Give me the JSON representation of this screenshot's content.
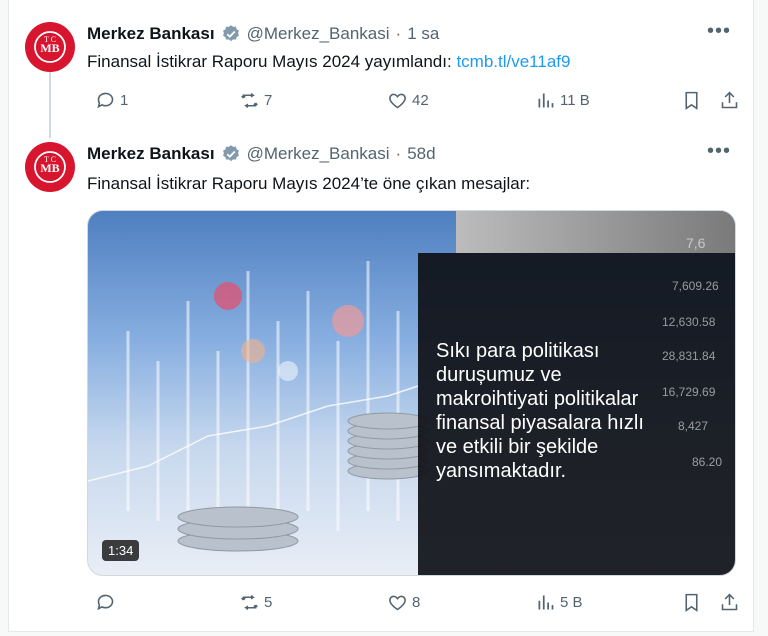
{
  "tweets": [
    {
      "name": "Merkez Bankası",
      "handle": "@Merkez_Bankasi",
      "dot": "·",
      "time": "1 sa",
      "text": "Finansal İstikrar Raporu Mayıs 2024 yayımlandı: ",
      "link": "tcmb.tl/ve11af9",
      "replies": "1",
      "retweets": "7",
      "likes": "42",
      "views": "11 B"
    },
    {
      "name": "Merkez Bankası",
      "handle": "@Merkez_Bankasi",
      "dot": "·",
      "time": "58d",
      "text": "Finansal İstikrar Raporu Mayıs 2024’te öne çıkan mesajlar:",
      "replies": "",
      "retweets": "5",
      "likes": "8",
      "views": "5 B",
      "media": {
        "overlay": "Sıkı para politikası\ndurușumuz ve\nmakroihtiyati politikalar\nfinansal piyasalara hızlı\nve etkili bir şekilde\nyansımaktadır.",
        "duration": "1:34",
        "tickers": [
          "7,6",
          "7,609.26",
          "12,630.58",
          "28,831.84",
          "16,729.69",
          "8,427",
          "86.20"
        ]
      }
    }
  ],
  "avatar_text": "TCMB",
  "colors": {
    "brand_red": "#d8152e",
    "link_blue": "#1d9bf0",
    "muted": "#536471",
    "verified_blue": "#1d9bf0"
  }
}
